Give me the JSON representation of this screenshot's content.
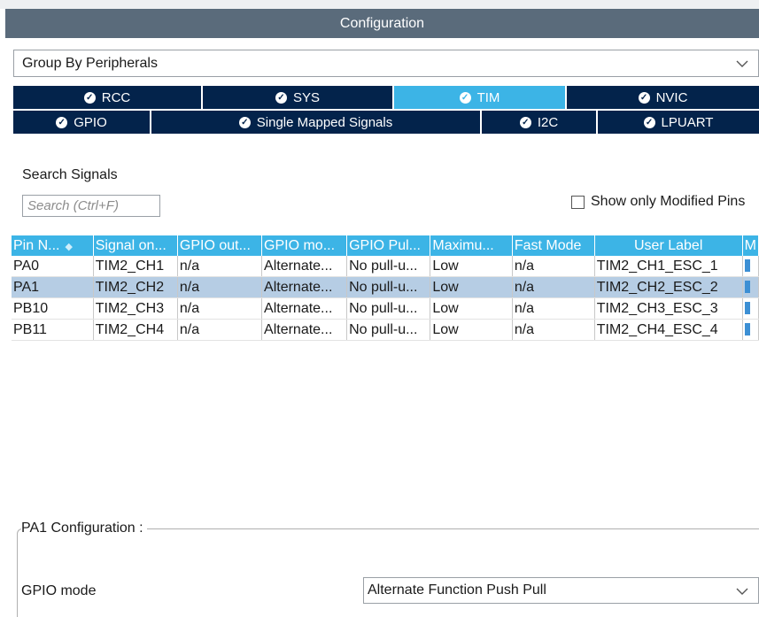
{
  "window": {
    "title": "Configuration"
  },
  "group_by": {
    "value": "Group By Peripherals"
  },
  "tabs_row1": [
    {
      "label": "RCC",
      "active": false
    },
    {
      "label": "SYS",
      "active": false
    },
    {
      "label": "TIM",
      "active": true
    },
    {
      "label": "NVIC",
      "active": false
    }
  ],
  "tabs_row2": [
    {
      "label": "GPIO",
      "active": false
    },
    {
      "label": "Single Mapped Signals",
      "active": false
    },
    {
      "label": "I2C",
      "active": false
    },
    {
      "label": "LPUART",
      "active": false
    }
  ],
  "search": {
    "label": "Search Signals",
    "placeholder": "Search (Ctrl+F)"
  },
  "show_modified": {
    "label": "Show only Modified Pins",
    "checked": false
  },
  "table": {
    "headers": [
      "Pin N...",
      "Signal on...",
      "GPIO out...",
      "GPIO mo...",
      "GPIO Pul...",
      "Maximu...",
      "Fast Mode",
      "User Label",
      "M"
    ],
    "rows": [
      [
        "PA0",
        "TIM2_CH1",
        "n/a",
        "Alternate...",
        "No pull-u...",
        "Low",
        "n/a",
        "TIM2_CH1_ESC_1",
        "✓"
      ],
      [
        "PA1",
        "TIM2_CH2",
        "n/a",
        "Alternate...",
        "No pull-u...",
        "Low",
        "n/a",
        "TIM2_CH2_ESC_2",
        "✓"
      ],
      [
        "PB10",
        "TIM2_CH3",
        "n/a",
        "Alternate...",
        "No pull-u...",
        "Low",
        "n/a",
        "TIM2_CH3_ESC_3",
        "✓"
      ],
      [
        "PB11",
        "TIM2_CH4",
        "n/a",
        "Alternate...",
        "No pull-u...",
        "Low",
        "n/a",
        "TIM2_CH4_ESC_4",
        "✓"
      ]
    ],
    "selected_row": 1
  },
  "pin_config": {
    "title": "PA1 Configuration :",
    "gpio_mode_label": "GPIO mode",
    "gpio_mode_value": "Alternate Function Push Pull"
  },
  "colors": {
    "tab_bg": "#03234b",
    "tab_active": "#3cb4e6",
    "header_bg": "#3cb4e6",
    "title_bar": "#5a6b7b",
    "row_selected": "#b6cde4"
  },
  "icons": {
    "tab_status": "check-circle-icon",
    "dropdown": "chevron-down-icon",
    "sort": "sort-icon"
  }
}
